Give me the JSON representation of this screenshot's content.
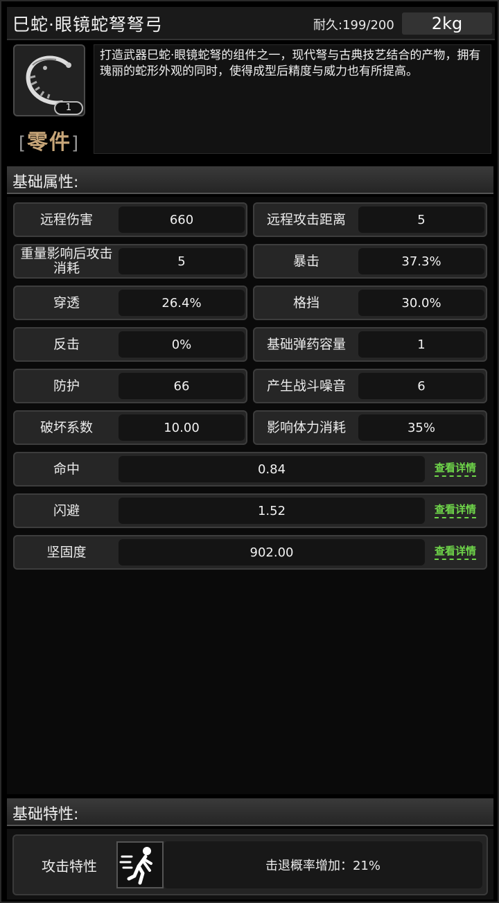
{
  "header": {
    "title": "巳蛇·眼镜蛇弩弩弓",
    "durability": "耐久:199/200",
    "weight": "2kg"
  },
  "item": {
    "icon": "serpent-crossbow-bow-icon",
    "count": "1",
    "category": "零件",
    "bracket_left": "[",
    "bracket_right": "]",
    "description": "打造武器巳蛇·眼镜蛇弩的组件之一，现代弩与古典技艺结合的产物，拥有瑰丽的蛇形外观的同时，使得成型后精度与威力也有所提高。"
  },
  "sections": {
    "base_attributes": "基础属性:",
    "base_traits": "基础特性:"
  },
  "attributes": [
    {
      "label": "远程伤害",
      "value": "660"
    },
    {
      "label": "远程攻击距离",
      "value": "5"
    },
    {
      "label": "重量影响后攻击消耗",
      "value": "5"
    },
    {
      "label": "暴击",
      "value": "37.3%"
    },
    {
      "label": "穿透",
      "value": "26.4%"
    },
    {
      "label": "格挡",
      "value": "30.0%"
    },
    {
      "label": "反击",
      "value": "0%"
    },
    {
      "label": "基础弹药容量",
      "value": "1"
    },
    {
      "label": "防护",
      "value": "66"
    },
    {
      "label": "产生战斗噪音",
      "value": "6"
    },
    {
      "label": "破坏系数",
      "value": "10.00"
    },
    {
      "label": "影响体力消耗",
      "value": "35%"
    }
  ],
  "detail_attributes": [
    {
      "label": "命中",
      "value": "0.84",
      "link": "查看详情"
    },
    {
      "label": "闪避",
      "value": "1.52",
      "link": "查看详情"
    },
    {
      "label": "坚固度",
      "value": "902.00",
      "link": "查看详情"
    }
  ],
  "traits": [
    {
      "label": "攻击特性",
      "icon": "knockback-figure-icon",
      "value": "击退概率增加：21%"
    }
  ],
  "colors": {
    "category": "#c8a679",
    "detail_link": "#6fd64a",
    "background": "#000000"
  }
}
